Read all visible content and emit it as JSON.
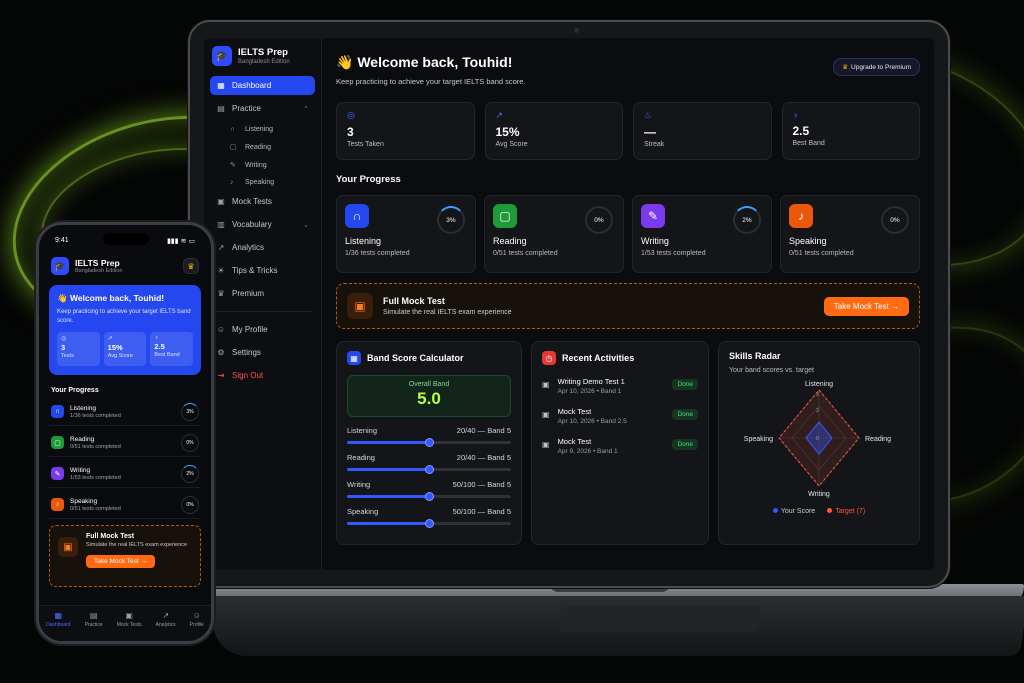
{
  "app": {
    "name": "IELTS Prep",
    "edition": "Bangladesh Edition"
  },
  "sidebar": {
    "items": [
      {
        "label": "Dashboard",
        "icon": "grid-icon"
      },
      {
        "label": "Practice",
        "icon": "book-icon"
      },
      {
        "label": "Mock Tests",
        "icon": "clipboard-icon"
      },
      {
        "label": "Vocabulary",
        "icon": "book-icon"
      },
      {
        "label": "Analytics",
        "icon": "chart-icon"
      },
      {
        "label": "Tips & Tricks",
        "icon": "lightbulb-icon"
      },
      {
        "label": "Premium",
        "icon": "crown-icon"
      }
    ],
    "practice_sub": [
      "Listening",
      "Reading",
      "Writing",
      "Speaking"
    ],
    "bottom": [
      {
        "label": "My Profile",
        "icon": "user-icon"
      },
      {
        "label": "Settings",
        "icon": "gear-icon"
      },
      {
        "label": "Sign Out",
        "icon": "logout-icon"
      }
    ]
  },
  "header": {
    "welcome": "👋 Welcome back, Touhid!",
    "subtitle": "Keep practicing to achieve your target IELTS band score.",
    "upgrade_label": "Upgrade to Premium"
  },
  "stats": [
    {
      "value": "3",
      "label": "Tests Taken",
      "icon": "target-icon"
    },
    {
      "value": "15%",
      "label": "Avg Score",
      "icon": "trend-icon"
    },
    {
      "value": "—",
      "label": "Streak",
      "icon": "flame-icon"
    },
    {
      "value": "2.5",
      "label": "Best Band",
      "icon": "award-icon"
    }
  ],
  "progress": {
    "title": "Your Progress",
    "modules": [
      {
        "name": "Listening",
        "sub": "1/36 tests completed",
        "pct": "3%",
        "color": "#2447f0"
      },
      {
        "name": "Reading",
        "sub": "0/51 tests completed",
        "pct": "0%",
        "color": "#1f9a3a"
      },
      {
        "name": "Writing",
        "sub": "1/53 tests completed",
        "pct": "2%",
        "color": "#7c3aed"
      },
      {
        "name": "Speaking",
        "sub": "0/51 tests completed",
        "pct": "0%",
        "color": "#ea580c"
      }
    ]
  },
  "mock": {
    "title": "Full Mock Test",
    "subtitle": "Simulate the real IELTS exam experience",
    "button": "Take Mock Test →"
  },
  "calculator": {
    "title": "Band Score Calculator",
    "overall_label": "Overall Band",
    "overall_value": "5.0",
    "rows": [
      {
        "skill": "Listening",
        "value": "20/40 — Band 5",
        "fraction": 0.5
      },
      {
        "skill": "Reading",
        "value": "20/40 — Band 5",
        "fraction": 0.5
      },
      {
        "skill": "Writing",
        "value": "50/100 — Band 5",
        "fraction": 0.5
      },
      {
        "skill": "Speaking",
        "value": "50/100 — Band 5",
        "fraction": 0.5
      }
    ]
  },
  "activities": {
    "title": "Recent Activities",
    "items": [
      {
        "name": "Writing Demo Test 1",
        "meta": "Apr 10, 2026 • Band 1",
        "status": "Done"
      },
      {
        "name": "Mock Test",
        "meta": "Apr 10, 2026 • Band 2.5",
        "status": "Done"
      },
      {
        "name": "Mock Test",
        "meta": "Apr 9, 2026 • Band 1",
        "status": "Done"
      }
    ]
  },
  "radar": {
    "title": "Skills Radar",
    "subtitle": "Your band scores vs. target",
    "axes": [
      "Listening",
      "Reading",
      "Writing",
      "Speaking"
    ],
    "tick_labels": [
      "3",
      "3",
      "0"
    ],
    "legend_score": "Your Score",
    "legend_target": "Target (7)",
    "score_color": "#3358ff",
    "target_color": "#ff5a3c"
  },
  "phone": {
    "time": "9:41",
    "signal": "▮▮▮ ≋ ▭",
    "welcome": "👋 Welcome back, Touhid!",
    "subtitle": "Keep practicing to achieve your target IELTS band score.",
    "stats": [
      {
        "value": "3",
        "label": "Tests"
      },
      {
        "value": "15%",
        "label": "Avg Score"
      },
      {
        "value": "2.5",
        "label": "Best Band"
      }
    ],
    "progress_title": "Your Progress",
    "mock_title": "Full Mock Test",
    "mock_sub": "Simulate the real IELTS exam experience",
    "mock_button": "Take Mock Test →",
    "tabs": [
      "Dashboard",
      "Practice",
      "Mock Tests",
      "Analytics",
      "Profile"
    ]
  }
}
